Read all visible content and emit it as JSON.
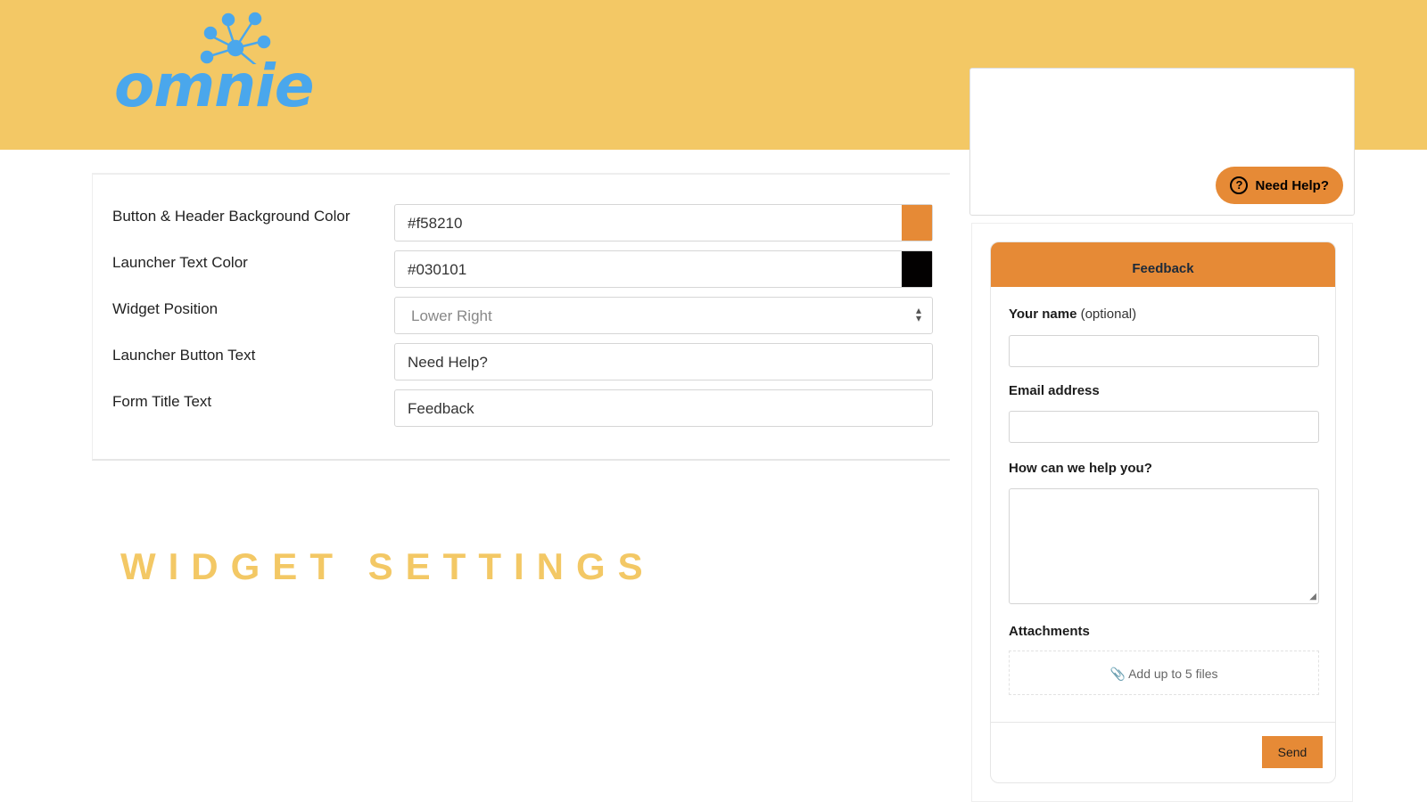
{
  "brand": {
    "logo_text": "omnie",
    "color": "#4aa7ec",
    "banner_color": "#f3c865"
  },
  "settings": {
    "rows": [
      {
        "label": "Button & Header Background Color",
        "value": "#f58210",
        "swatch": "#e68a36"
      },
      {
        "label": "Launcher Text Color",
        "value": "#030101",
        "swatch": "#030101"
      },
      {
        "label": "Widget Position",
        "value": "Lower Right"
      },
      {
        "label": "Launcher Button Text",
        "value": "Need Help?"
      },
      {
        "label": "Form Title Text",
        "value": "Feedback"
      }
    ]
  },
  "page_title": "WIDGET SETTINGS",
  "preview": {
    "launcher_label": "Need Help?",
    "launcher_icon": "question-circle-icon",
    "form_title": "Feedback",
    "name_label": "Your name",
    "name_optional": "(optional)",
    "email_label": "Email address",
    "help_label": "How can we help you?",
    "attachments_label": "Attachments",
    "attach_text": "Add up to 5 files",
    "attach_icon": "paperclip-icon",
    "send_label": "Send"
  }
}
